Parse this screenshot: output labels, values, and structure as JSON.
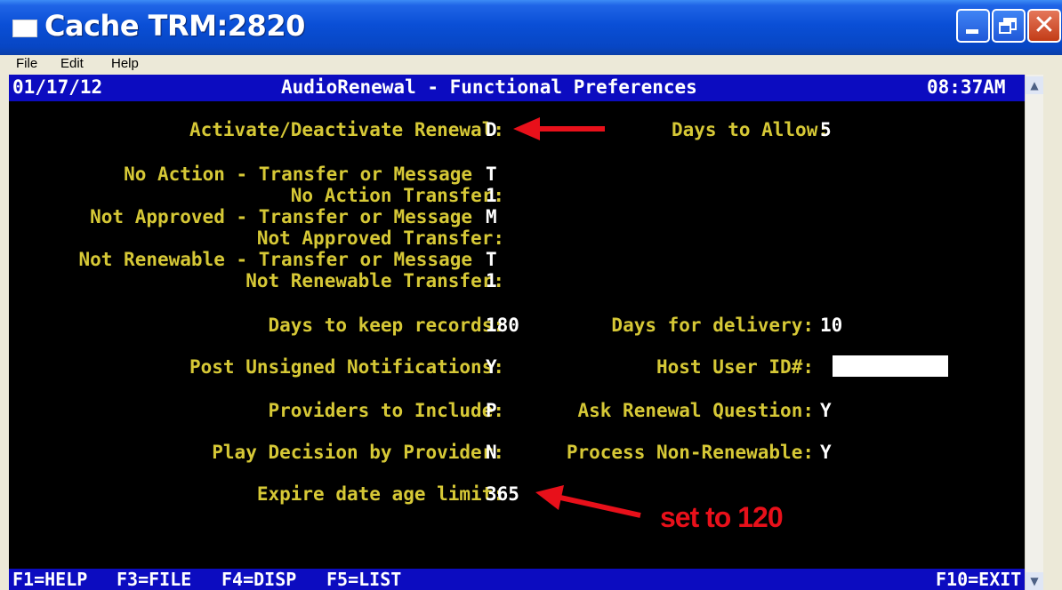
{
  "window": {
    "title": "Cache TRM:2820",
    "close_glyph": "✕"
  },
  "menu": {
    "file": "File",
    "edit": "Edit",
    "help": "Help"
  },
  "header": {
    "date": "01/17/12",
    "title": "AudioRenewal - Functional Preferences",
    "time": "08:37AM"
  },
  "fields": {
    "activate_label": "Activate/Deactivate Renewal:",
    "activate_value": "D",
    "days_allow_label": "Days to Allow:",
    "days_allow_value": "5",
    "no_action_label": "No Action - Transfer or Message",
    "no_action_value": "T",
    "no_action_transfer_label": "No Action Transfer:",
    "no_action_transfer_value": "1",
    "not_approved_label": "Not Approved - Transfer or Message",
    "not_approved_value": "M",
    "not_approved_transfer_label": "Not Approved Transfer:",
    "not_approved_transfer_value": "",
    "not_renewable_label": "Not Renewable - Transfer or Message",
    "not_renewable_value": "T",
    "not_renewable_transfer_label": "Not Renewable Transfer:",
    "not_renewable_transfer_value": "1",
    "days_keep_label": "Days to keep records:",
    "days_keep_value": "180",
    "days_delivery_label": "Days for delivery:",
    "days_delivery_value": "10",
    "post_unsigned_label": "Post Unsigned Notifications:",
    "post_unsigned_value": "Y",
    "host_user_label": "Host User ID#:",
    "host_user_value": "",
    "providers_label": "Providers to Include:",
    "providers_value": "P",
    "ask_renewal_label": "Ask Renewal Question:",
    "ask_renewal_value": "Y",
    "play_decision_label": "Play Decision by Provider:",
    "play_decision_value": "N",
    "process_nonrenew_label": "Process Non-Renewable:",
    "process_nonrenew_value": "Y",
    "expire_label": "Expire date age limit:",
    "expire_value": "365"
  },
  "fkeys": {
    "f1": "F1=HELP",
    "f3": "F3=FILE",
    "f4": "F4=DISP",
    "f5": "F5=LIST",
    "f10": "F10=EXIT"
  },
  "scrollbar": {
    "up": "▲",
    "down": "▼"
  },
  "annotation": {
    "note": "set to 120",
    "color": "#e8101a"
  },
  "colors": {
    "label": "#d6c836",
    "value": "#ffffff",
    "header_bg": "#0c0cc0",
    "terminal_bg": "#000000"
  }
}
